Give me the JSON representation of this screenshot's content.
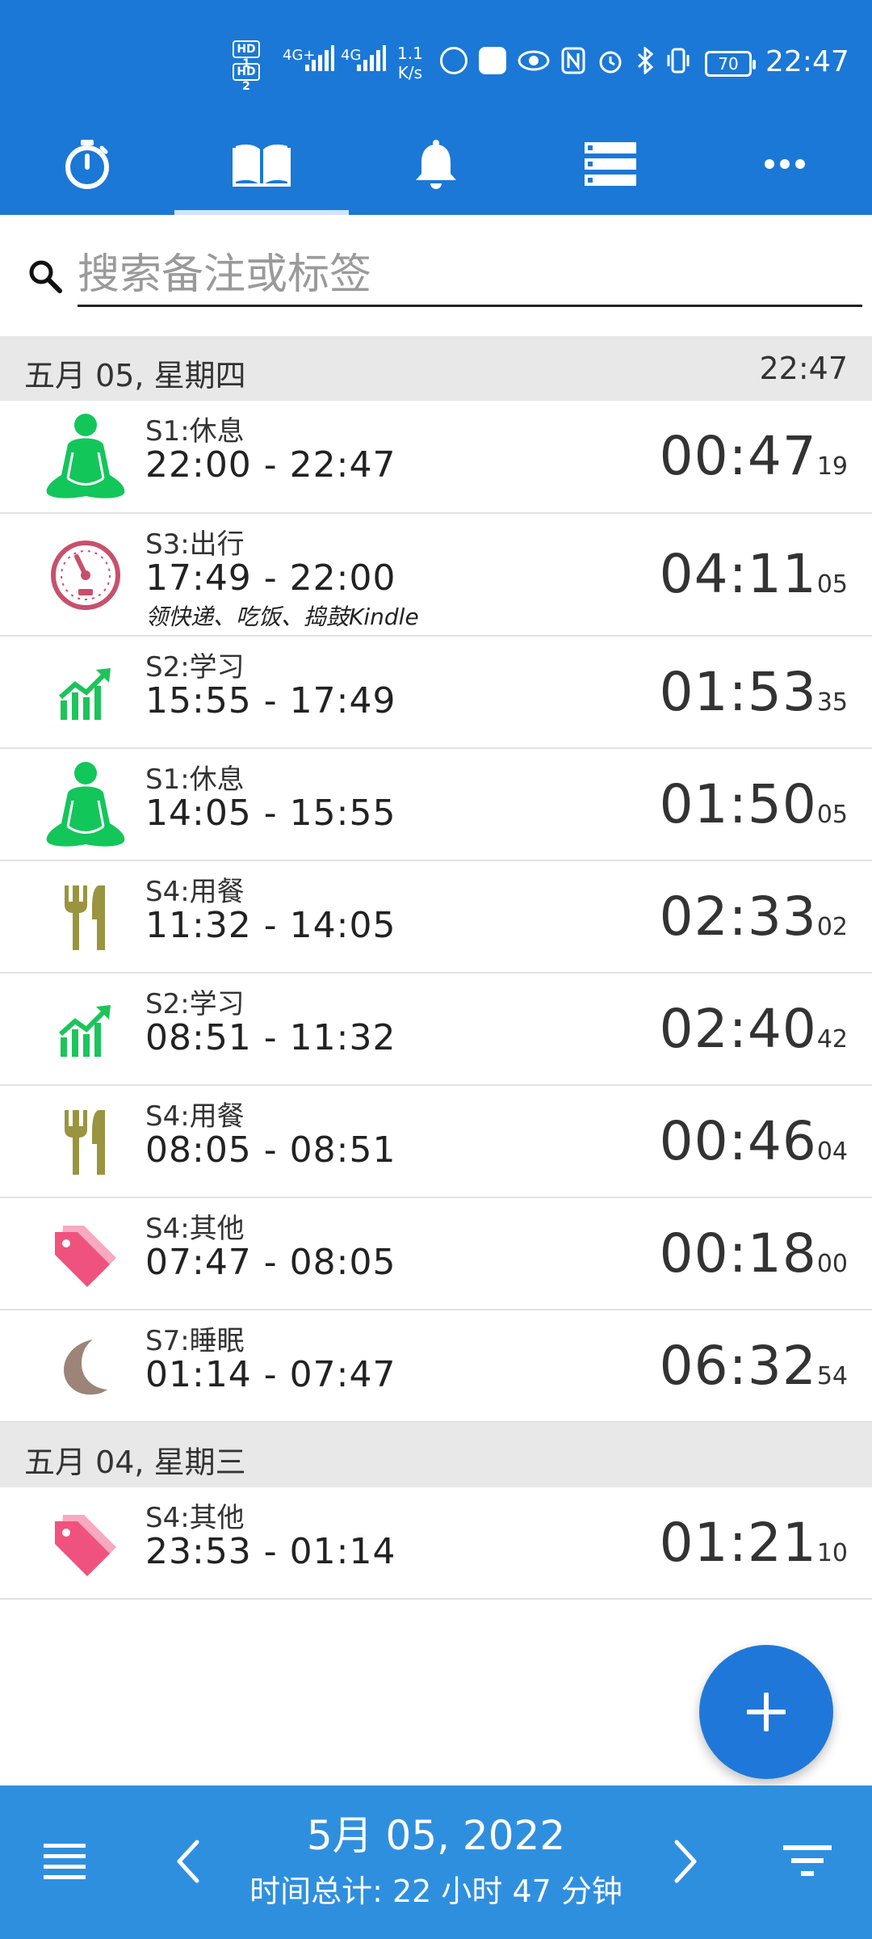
{
  "status_bar": {
    "hd_labels": [
      "HD 1",
      "HD 2"
    ],
    "network_1": "4G+",
    "network_2": "4G",
    "speed_value": "1.1",
    "speed_unit": "K/s",
    "battery": "70",
    "time": "22:47"
  },
  "tabs": [
    {
      "icon": "stopwatch-icon",
      "active": false
    },
    {
      "icon": "book-icon",
      "active": true
    },
    {
      "icon": "bell-icon",
      "active": false
    },
    {
      "icon": "list-icon",
      "active": false
    },
    {
      "icon": "more-icon",
      "active": false
    }
  ],
  "search": {
    "placeholder": "搜索备注或标签"
  },
  "days": [
    {
      "label": "五月 05, 星期四",
      "time": "22:47",
      "entries": [
        {
          "category": "S1:休息",
          "range": "22:00 - 22:47",
          "duration": "00:47",
          "seconds": "19",
          "icon": "meditation-icon",
          "note": ""
        },
        {
          "category": "S3:出行",
          "range": "17:49 - 22:00",
          "duration": "04:11",
          "seconds": "05",
          "icon": "speedometer-icon",
          "note": "领快递、吃饭、捣鼓Kindle"
        },
        {
          "category": "S2:学习",
          "range": "15:55 - 17:49",
          "duration": "01:53",
          "seconds": "35",
          "icon": "growth-chart-icon",
          "note": ""
        },
        {
          "category": "S1:休息",
          "range": "14:05 - 15:55",
          "duration": "01:50",
          "seconds": "05",
          "icon": "meditation-icon",
          "note": ""
        },
        {
          "category": "S4:用餐",
          "range": "11:32 - 14:05",
          "duration": "02:33",
          "seconds": "02",
          "icon": "fork-knife-icon",
          "note": ""
        },
        {
          "category": "S2:学习",
          "range": "08:51 - 11:32",
          "duration": "02:40",
          "seconds": "42",
          "icon": "growth-chart-icon",
          "note": ""
        },
        {
          "category": "S4:用餐",
          "range": "08:05 - 08:51",
          "duration": "00:46",
          "seconds": "04",
          "icon": "fork-knife-icon",
          "note": ""
        },
        {
          "category": "S4:其他",
          "range": "07:47 - 08:05",
          "duration": "00:18",
          "seconds": "00",
          "icon": "tag-icon",
          "note": ""
        },
        {
          "category": "S7:睡眠",
          "range": "01:14 - 07:47",
          "duration": "06:32",
          "seconds": "54",
          "icon": "moon-icon",
          "note": ""
        }
      ]
    },
    {
      "label": "五月 04, 星期三",
      "time": "",
      "entries": [
        {
          "category": "S4:其他",
          "range": "23:53 - 01:14",
          "duration": "01:21",
          "seconds": "10",
          "icon": "tag-icon",
          "note": ""
        }
      ]
    }
  ],
  "bottom_bar": {
    "date": "5月 05, 2022",
    "total": "时间总计: 22 小时 47 分钟"
  },
  "colors": {
    "app_bar": "#1b78d6",
    "bottom_bar": "#2f8fdf",
    "fab": "#1f78d9",
    "rest_green": "#12c65a",
    "study_green": "#1cc45a",
    "travel_red": "#c8506c",
    "meal_olive": "#9a9440",
    "tag_pink": "#f0527e",
    "moon_brown": "#9c8478"
  }
}
